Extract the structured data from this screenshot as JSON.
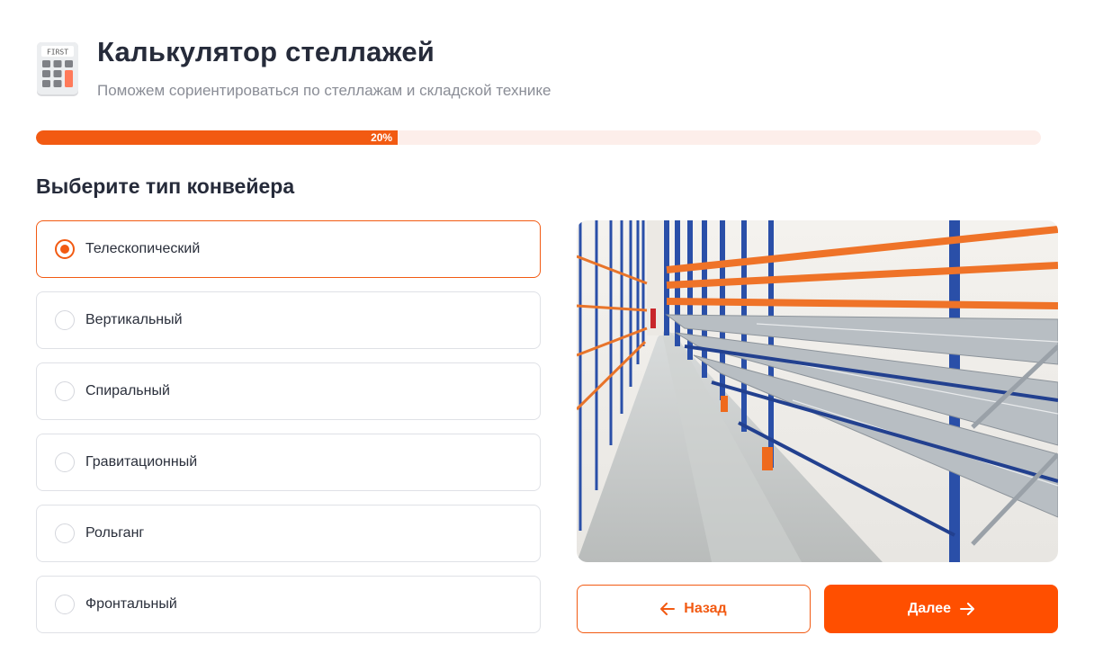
{
  "header": {
    "icon": "calculator-icon",
    "icon_text": "FIRST",
    "title": "Калькулятор стеллажей",
    "subtitle": "Поможем сориентироваться по стеллажам и складской технике"
  },
  "progress": {
    "percent": 20,
    "label": "20%"
  },
  "question": "Выберите тип конвейера",
  "options": [
    {
      "label": "Телескопический",
      "selected": true
    },
    {
      "label": "Вертикальный",
      "selected": false
    },
    {
      "label": "Спиральный",
      "selected": false
    },
    {
      "label": "Гравитационный",
      "selected": false
    },
    {
      "label": "Рольганг",
      "selected": false
    },
    {
      "label": "Фронтальный",
      "selected": false
    }
  ],
  "image": {
    "subject": "warehouse-rack-photo"
  },
  "buttons": {
    "back": "Назад",
    "next": "Далее",
    "back_icon": "arrow-left-icon",
    "next_icon": "arrow-right-icon"
  },
  "colors": {
    "accent": "#f25a12",
    "button": "#ff4f00",
    "progress_track": "#fdeeea"
  }
}
